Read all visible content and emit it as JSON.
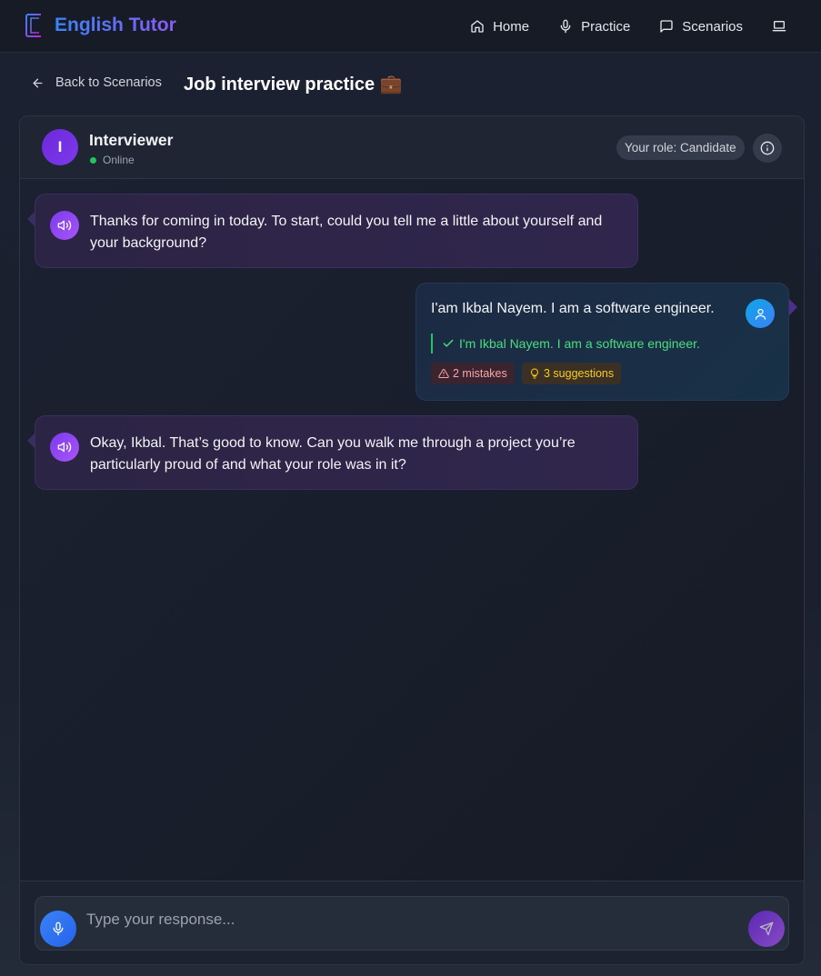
{
  "app": {
    "name": "English Tutor",
    "brand_gradient": [
      "#3b82f6",
      "#8b5cf6"
    ]
  },
  "nav": {
    "items": [
      {
        "label": "Home",
        "icon": "home-icon"
      },
      {
        "label": "Practice",
        "icon": "mic-icon"
      },
      {
        "label": "Scenarios",
        "icon": "chat-icon"
      }
    ],
    "extra_icon": "laptop-icon"
  },
  "page": {
    "back_label": "Back to Scenarios",
    "title": "Job interview practice 💼"
  },
  "chat": {
    "partner": {
      "initial": "I",
      "name": "Interviewer",
      "status": "Online"
    },
    "role_badge": "Your role: Candidate",
    "messages": [
      {
        "sender": "ai",
        "text": "Thanks for coming in today. To start, could you tell me a little about yourself and your background?"
      },
      {
        "sender": "user",
        "text": "I'am Ikbal Nayem. I am a software engineer.",
        "correction": "I'm Ikbal Nayem. I am a software engineer.",
        "mistakes_label": "2 mistakes",
        "suggestions_label": "3 suggestions"
      },
      {
        "sender": "ai",
        "text": "Okay, Ikbal. That’s good to know. Can you walk me through a project you’re particularly proud of and what your role was in it?"
      }
    ],
    "input_placeholder": "Type your response..."
  },
  "colors": {
    "status_online": "#22c55e",
    "correction": "#4ade80",
    "mistakes": "#fca5a5",
    "suggestions": "#facc15",
    "accent_purple": "#7c3aed",
    "accent_blue": "#3b82f6"
  }
}
